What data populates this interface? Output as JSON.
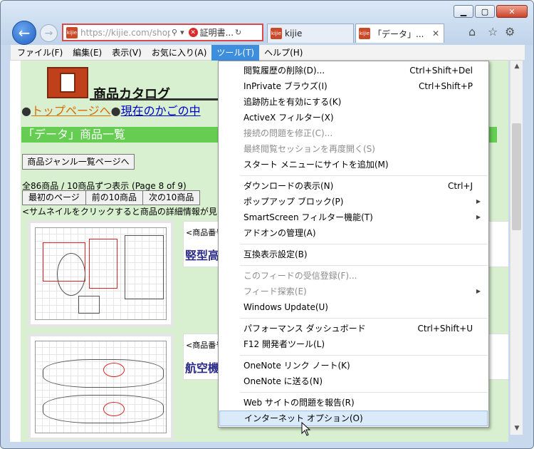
{
  "browser": {
    "url": "https://kijie.com/shop",
    "cert_label": "証明書...",
    "tabs": [
      {
        "label": "kijie"
      },
      {
        "label": "「データ」..."
      }
    ],
    "favicon_text": "kijie"
  },
  "menubar": [
    {
      "label": "ファイル(F)"
    },
    {
      "label": "編集(E)"
    },
    {
      "label": "表示(V)"
    },
    {
      "label": "お気に入り(A)"
    },
    {
      "label": "ツール(T)"
    },
    {
      "label": "ヘルプ(H)"
    }
  ],
  "page": {
    "logo_title": "商品カタログ",
    "link_top": "トップページへ",
    "link_cart": "現在のかごの中",
    "section_title": "「データ」商品一覧",
    "genre_button": "商品ジャンル一覧ページへ",
    "count_text": "全86商品 / 10商品ずつ表示 (Page 8 of 9)",
    "nav_buttons": [
      "最初のページ",
      "前の10商品",
      "次の10商品"
    ],
    "hint": "<サムネイルをクリックすると商品の詳細情報が見",
    "products": [
      {
        "number_label": "<商品番号:",
        "name": "竪型高"
      },
      {
        "number_label": "<商品番号:",
        "name": "航空機"
      }
    ]
  },
  "tools_menu": {
    "items": [
      {
        "label": "閲覧履歴の削除(D)...",
        "shortcut": "Ctrl+Shift+Del"
      },
      {
        "label": "InPrivate ブラウズ(I)",
        "shortcut": "Ctrl+Shift+P"
      },
      {
        "label": "追跡防止を有効にする(K)",
        "shortcut": ""
      },
      {
        "label": "ActiveX フィルター(X)",
        "shortcut": ""
      },
      {
        "label": "接続の問題を修正(C)...",
        "shortcut": ""
      },
      {
        "label": "最終閲覧セッションを再度開く(S)",
        "shortcut": ""
      },
      {
        "label": "スタート メニューにサイトを追加(M)",
        "shortcut": ""
      },
      {
        "label": "ダウンロードの表示(N)",
        "shortcut": "Ctrl+J"
      },
      {
        "label": "ポップアップ ブロック(P)",
        "shortcut": ""
      },
      {
        "label": "SmartScreen フィルター機能(T)",
        "shortcut": ""
      },
      {
        "label": "アドオンの管理(A)",
        "shortcut": ""
      },
      {
        "label": "互換表示設定(B)",
        "shortcut": ""
      },
      {
        "label": "このフィードの受信登録(F)...",
        "shortcut": ""
      },
      {
        "label": "フィード探索(E)",
        "shortcut": ""
      },
      {
        "label": "Windows Update(U)",
        "shortcut": ""
      },
      {
        "label": "パフォーマンス ダッシュボード",
        "shortcut": "Ctrl+Shift+U"
      },
      {
        "label": "F12 開発者ツール(L)",
        "shortcut": ""
      },
      {
        "label": "OneNote リンク ノート(K)",
        "shortcut": ""
      },
      {
        "label": "OneNote に送る(N)",
        "shortcut": ""
      },
      {
        "label": "Web サイトの問題を報告(R)",
        "shortcut": ""
      },
      {
        "label": "インターネット オプション(O)",
        "shortcut": ""
      }
    ]
  }
}
